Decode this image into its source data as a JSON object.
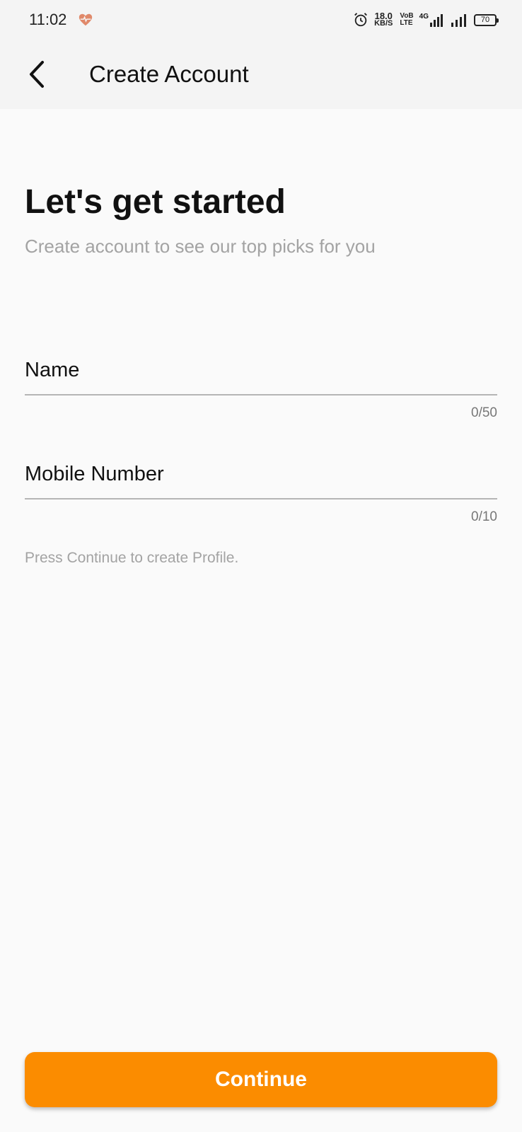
{
  "status_bar": {
    "time": "11:02",
    "net_speed_value": "18.0",
    "net_speed_unit": "KB/S",
    "volte_top": "VoB",
    "volte_bottom": "LTE",
    "network_type": "4G",
    "battery_level": "70",
    "icons": [
      "heart-health-icon",
      "alarm-icon",
      "signal-icon",
      "battery-icon"
    ],
    "heart_color": "#e0896a"
  },
  "app_bar": {
    "back_icon": "chevron-left-icon",
    "title": "Create Account"
  },
  "intro": {
    "heading": "Let's get started",
    "subheading": "Create account to see our top picks for you"
  },
  "form": {
    "name": {
      "label": "Name",
      "value": "",
      "counter": "0/50"
    },
    "mobile": {
      "label": "Mobile Number",
      "value": "",
      "counter": "0/10"
    },
    "hint": "Press Continue to create Profile."
  },
  "actions": {
    "continue_label": "Continue",
    "accent_color": "#fb8c00"
  }
}
